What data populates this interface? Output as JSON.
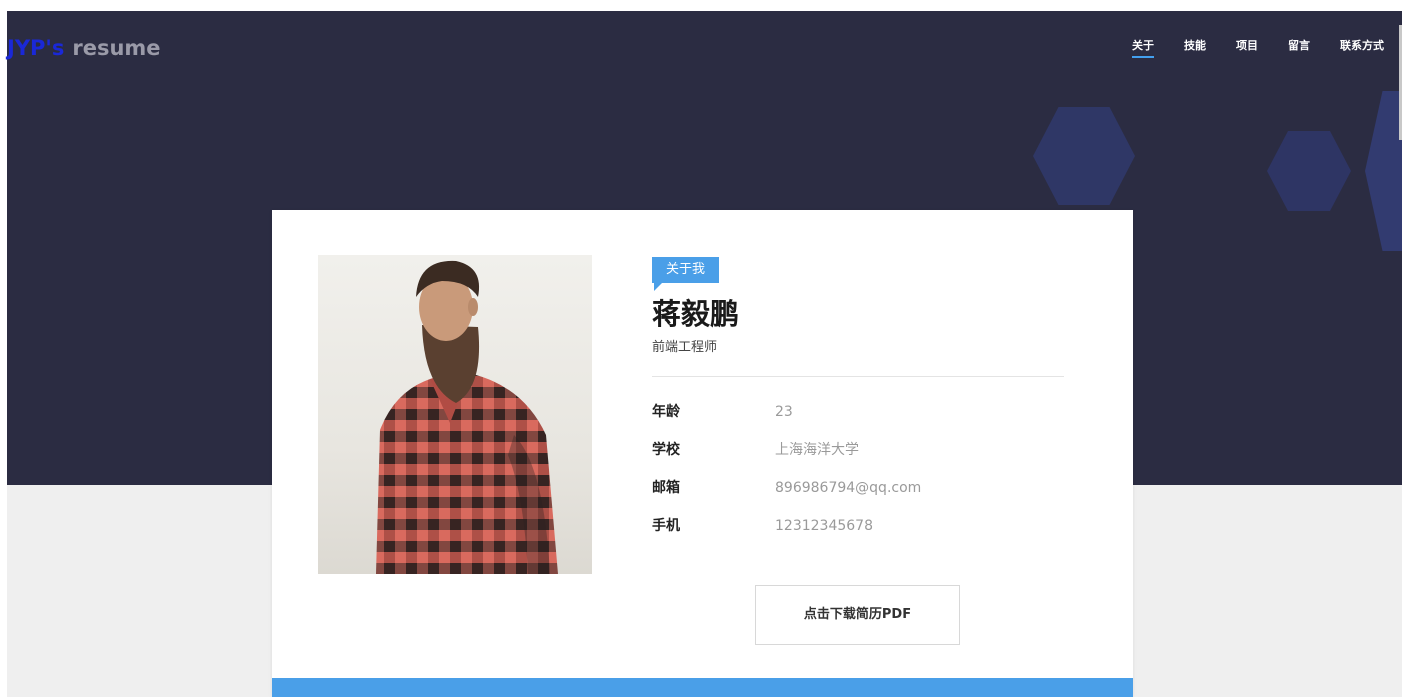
{
  "brand": {
    "part1": "JYP's",
    "part2": "resume"
  },
  "nav": {
    "items": [
      {
        "label": "关于",
        "active": true
      },
      {
        "label": "技能",
        "active": false
      },
      {
        "label": "项目",
        "active": false
      },
      {
        "label": "留言",
        "active": false
      },
      {
        "label": "联系方式",
        "active": false
      }
    ]
  },
  "about": {
    "tag": "关于我",
    "name": "蒋毅鹏",
    "role": "前端工程师",
    "photo_icon": "portrait-photo",
    "fields": [
      {
        "key": "年龄",
        "value": "23"
      },
      {
        "key": "学校",
        "value": "上海海洋大学"
      },
      {
        "key": "邮箱",
        "value": "896986794@qq.com"
      },
      {
        "key": "手机",
        "value": "12312345678"
      }
    ],
    "download_label": "点击下载简历PDF"
  },
  "colors": {
    "header_bg": "#2b2c42",
    "accent": "#4a9fe8",
    "logo_blue": "#1a28d8",
    "page_bg": "#efefef"
  }
}
